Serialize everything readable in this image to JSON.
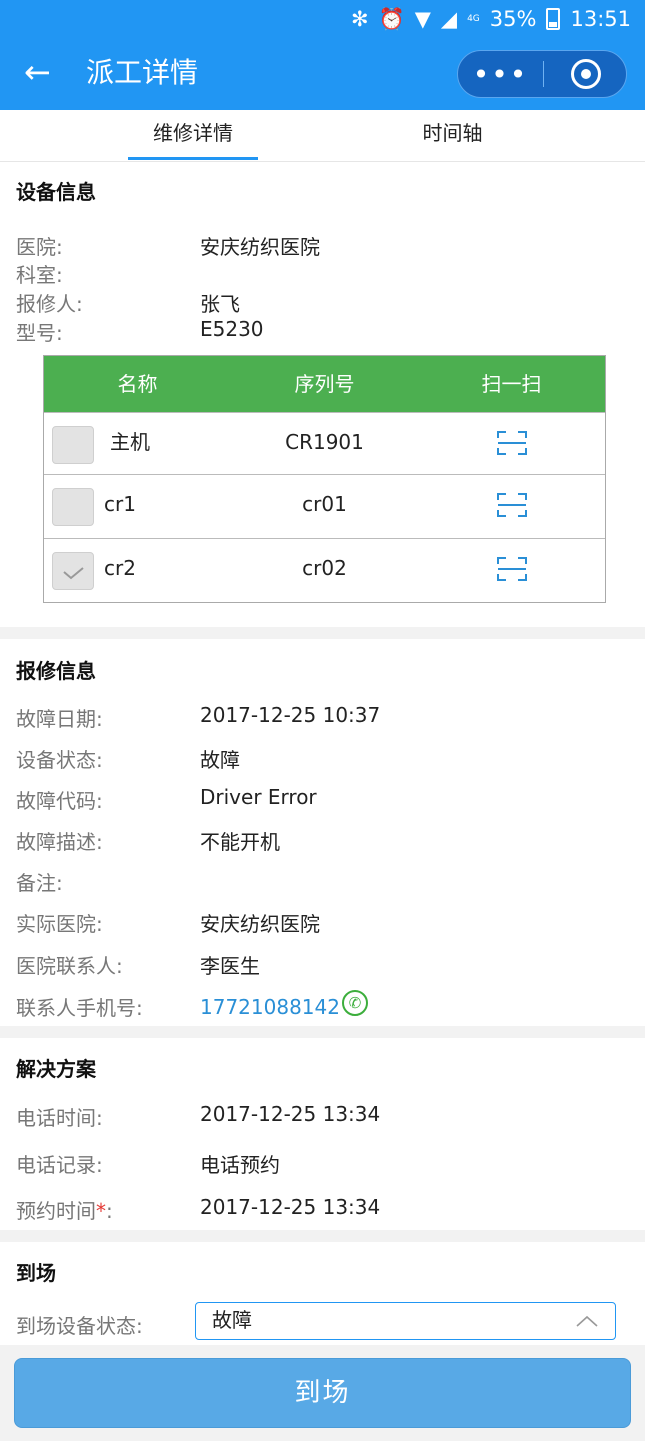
{
  "status_bar": {
    "bluetooth": "✻",
    "alarm": "⏰",
    "wifi": "▼",
    "signal": "◢",
    "network": "4G",
    "battery": "35%",
    "time": "13:51"
  },
  "header": {
    "back_icon": "←",
    "title": "派工详情",
    "more": "•••"
  },
  "tabs": [
    {
      "label": "维修详情"
    },
    {
      "label": "时间轴"
    }
  ],
  "device_info": {
    "title": "设备信息",
    "fields": [
      {
        "label": "医院:",
        "value": "安庆纺织医院"
      },
      {
        "label": "科室:",
        "value": ""
      },
      {
        "label": "报修人:",
        "value": "张飞"
      },
      {
        "label": "型号:",
        "value": "E5230"
      }
    ],
    "table": {
      "headers": [
        "名称",
        "序列号",
        "扫一扫"
      ],
      "rows": [
        {
          "name": "主机",
          "serial": "CR1901",
          "checked": false
        },
        {
          "name": "cr1",
          "serial": "cr01",
          "checked": false
        },
        {
          "name": "cr2",
          "serial": "cr02",
          "checked": true
        }
      ]
    }
  },
  "repair_info": {
    "title": "报修信息",
    "fields": [
      {
        "label": "故障日期:",
        "value": "2017-12-25 10:37"
      },
      {
        "label": "设备状态:",
        "value": "故障"
      },
      {
        "label": "故障代码:",
        "value": "Driver Error"
      },
      {
        "label": "故障描述:",
        "value": "不能开机"
      },
      {
        "label": "备注:",
        "value": ""
      },
      {
        "label": "实际医院:",
        "value": "安庆纺织医院"
      },
      {
        "label": "医院联系人:",
        "value": "李医生"
      },
      {
        "label": "联系人手机号:",
        "value": "17721088142"
      }
    ]
  },
  "solution": {
    "title": "解决方案",
    "fields": [
      {
        "label": "电话时间:",
        "value": "2017-12-25 13:34"
      },
      {
        "label": "电话记录:",
        "value": "电话预约"
      },
      {
        "label": "预约时间",
        "required_mark": "*",
        "label_suffix": ":",
        "value": "2017-12-25 13:34"
      }
    ]
  },
  "arrival": {
    "title": "到场",
    "status_label": "到场设备状态:",
    "status_value": "故障"
  },
  "submit_label": "到场",
  "colors": {
    "primary": "#2196f3",
    "table_header": "#4caf50",
    "button": "#58a9e6",
    "phone": "#2a8fd6",
    "required": "#e53935"
  }
}
